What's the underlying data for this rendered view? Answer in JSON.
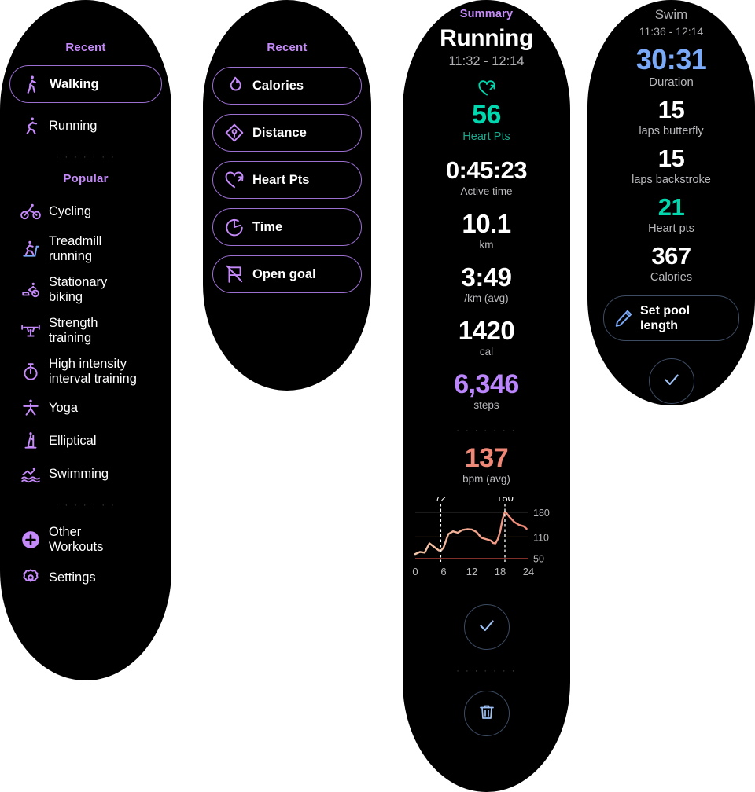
{
  "workouts_panel": {
    "recent_header": "Recent",
    "popular_header": "Popular",
    "recent": [
      {
        "label": "Walking",
        "icon": "walking-icon",
        "selected": true
      },
      {
        "label": "Running",
        "icon": "running-icon",
        "selected": false
      }
    ],
    "popular": [
      {
        "label": "Cycling",
        "icon": "cycling-icon"
      },
      {
        "label": "Treadmill running",
        "icon": "treadmill-icon"
      },
      {
        "label": "Stationary biking",
        "icon": "stationary-bike-icon"
      },
      {
        "label": "Strength training",
        "icon": "barbell-icon"
      },
      {
        "label": "High intensity interval training",
        "icon": "stopwatch-icon"
      },
      {
        "label": "Yoga",
        "icon": "yoga-icon"
      },
      {
        "label": "Elliptical",
        "icon": "elliptical-icon"
      },
      {
        "label": "Swimming",
        "icon": "swimming-icon"
      }
    ],
    "other": [
      {
        "label": "Other Workouts",
        "icon": "plus-circle-icon"
      },
      {
        "label": "Settings",
        "icon": "gear-icon"
      }
    ]
  },
  "goals_panel": {
    "recent_header": "Recent",
    "items": [
      {
        "label": "Calories",
        "icon": "flame-icon"
      },
      {
        "label": "Distance",
        "icon": "distance-pin-icon"
      },
      {
        "label": "Heart Pts",
        "icon": "heart-arrow-icon"
      },
      {
        "label": "Time",
        "icon": "timer-icon"
      },
      {
        "label": "Open goal",
        "icon": "flag-icon"
      }
    ]
  },
  "summary_panel": {
    "eyebrow": "Summary",
    "title": "Running",
    "time_range": "11:32 - 12:14",
    "heart_pts_icon": "heart-arrow-icon",
    "metrics": [
      {
        "value": "56",
        "unit": "Heart Pts",
        "color": "teal"
      },
      {
        "value": "0:45:23",
        "unit": "Active time",
        "color": "white"
      },
      {
        "value": "10.1",
        "unit": "km",
        "color": "white"
      },
      {
        "value": "3:49",
        "unit": "/km (avg)",
        "color": "white"
      },
      {
        "value": "1420",
        "unit": "cal",
        "color": "white"
      },
      {
        "value": "6,346",
        "unit": "steps",
        "color": "purple"
      },
      {
        "value": "137",
        "unit": "bpm (avg)",
        "color": "red"
      }
    ],
    "confirm_icon": "check-icon",
    "delete_icon": "trash-icon"
  },
  "swim_panel": {
    "title": "Swim",
    "time_range": "11:36 - 12:14",
    "metrics": [
      {
        "value": "30:31",
        "unit": "Duration",
        "color": "blue"
      },
      {
        "value": "15",
        "unit": "laps butterfly",
        "color": "white"
      },
      {
        "value": "15",
        "unit": "laps backstroke",
        "color": "white"
      },
      {
        "value": "21",
        "unit": "Heart pts",
        "color": "teal"
      },
      {
        "value": "367",
        "unit": "Calories",
        "color": "white"
      }
    ],
    "set_pool_label": "Set pool length",
    "set_pool_icon": "pencil-icon",
    "confirm_icon": "check-icon"
  },
  "colors": {
    "accent_purple": "#c58af9",
    "teal": "#00d7ae",
    "steps_purple": "#bb86fc",
    "bpm_red": "#f08878",
    "blue": "#7aa9f7",
    "panel_bg": "#000000",
    "page_bg": "#ffffff"
  },
  "chart_data": {
    "type": "line",
    "title": "",
    "xlabel": "",
    "ylabel": "",
    "x": [
      0,
      1,
      2,
      3,
      4,
      5,
      5.4,
      6,
      7,
      8,
      9,
      10,
      11,
      12,
      13,
      14,
      15,
      16,
      16.5,
      17,
      17.5,
      18,
      18.5,
      19,
      19.3,
      20,
      21,
      22,
      23,
      23.6
    ],
    "values": [
      62,
      68,
      66,
      92,
      82,
      72,
      71,
      80,
      118,
      126,
      122,
      130,
      132,
      131,
      124,
      108,
      104,
      100,
      93,
      92,
      104,
      126,
      160,
      181,
      178,
      166,
      152,
      144,
      140,
      133
    ],
    "xticks": [
      0,
      6,
      12,
      18,
      24
    ],
    "xtick_labels": [
      "0",
      "6",
      "12",
      "18",
      "24"
    ],
    "yticks": [
      50,
      110,
      180
    ],
    "ytick_labels": [
      "50",
      "110",
      "180"
    ],
    "ylim": [
      40,
      195
    ],
    "xlim": [
      0,
      24
    ],
    "annotations": [
      {
        "label": "72",
        "x": 5.4,
        "y": 71,
        "marker": "dashed-vline"
      },
      {
        "label": "180",
        "x": 19.0,
        "y": 181,
        "marker": "dashed-vline"
      }
    ],
    "gridlines": [
      {
        "y": 50,
        "color": "#7e2f2a"
      },
      {
        "y": 110,
        "color": "#7a4a22"
      },
      {
        "y": 180,
        "color": "#6b6b6b"
      }
    ],
    "line_colors": [
      "#f5c8a8",
      "#f08878"
    ],
    "grid": true,
    "legend": "none"
  }
}
